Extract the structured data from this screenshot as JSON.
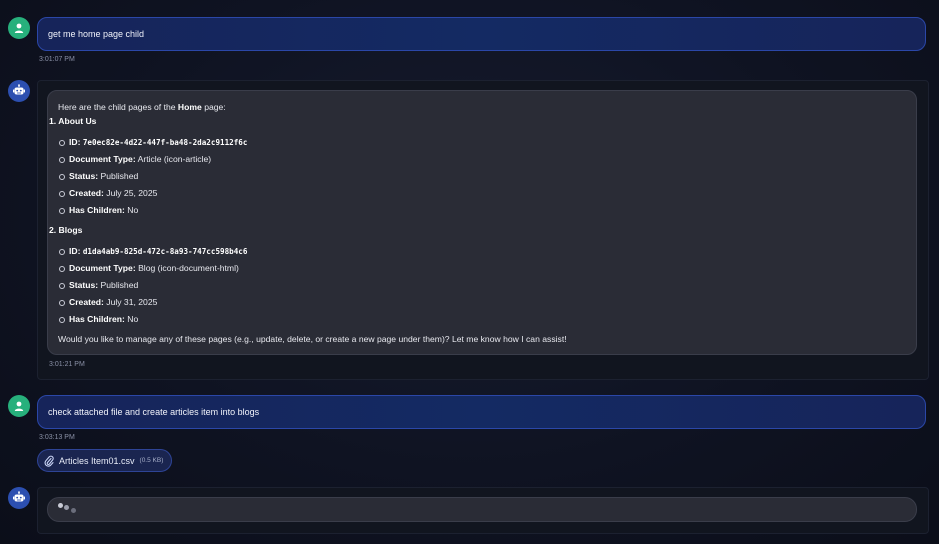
{
  "messages": {
    "user1": {
      "text": "get me home page child",
      "time": "3:01:07 PM"
    },
    "bot1": {
      "intro_pre": "Here are the child pages of the ",
      "intro_bold": "Home",
      "intro_post": " page:",
      "items": [
        {
          "heading": "1. About Us",
          "id_label": "ID:",
          "id_value": "7e0ec82e-4d22-447f-ba48-2da2c9112f6c",
          "type_label": "Document Type:",
          "type_value": "Article (icon-article)",
          "status_label": "Status:",
          "status_value": "Published",
          "created_label": "Created:",
          "created_value": "July 25, 2025",
          "children_label": "Has Children:",
          "children_value": "No"
        },
        {
          "heading": "2. Blogs",
          "id_label": "ID:",
          "id_value": "d1da4ab9-825d-472c-8a93-747cc598b4c6",
          "type_label": "Document Type:",
          "type_value": "Blog (icon-document-html)",
          "status_label": "Status:",
          "status_value": "Published",
          "created_label": "Created:",
          "created_value": "July 31, 2025",
          "children_label": "Has Children:",
          "children_value": "No"
        }
      ],
      "closing": "Would you like to manage any of these pages (e.g., update, delete, or create a new page under them)? Let me know how I can assist!",
      "time": "3:01:21 PM"
    },
    "user2": {
      "text": "check attached file and create articles item into blogs",
      "time": "3:03:13 PM",
      "attachment": {
        "name": "Articles Item01.csv",
        "size": "(0.5 KB)",
        "icon": "paperclip-icon"
      }
    },
    "bot2": {
      "status": "typing"
    }
  },
  "colors": {
    "user_avatar": "#27b07c",
    "bot_avatar": "#2c4fb0",
    "user_bubble": "#142a63"
  }
}
